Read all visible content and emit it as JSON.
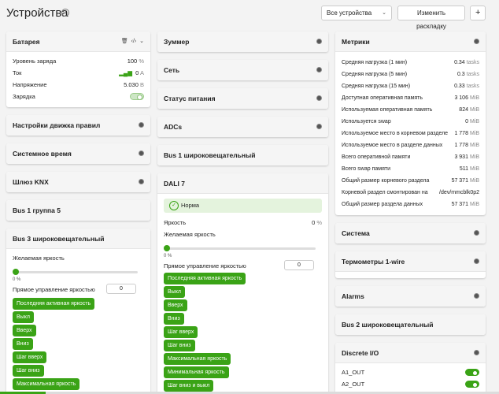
{
  "header": {
    "title": "Устройства",
    "devices_select": "Все устройства",
    "layout_button": "Изменить раскладку",
    "add_button": "+"
  },
  "battery": {
    "title": "Батарея",
    "rows": [
      {
        "label": "Уровень заряда",
        "value": "100",
        "unit": "%"
      },
      {
        "label": "Ток",
        "value": "0",
        "unit": "A"
      },
      {
        "label": "Напряжение",
        "value": "5.030",
        "unit": "В"
      },
      {
        "label": "Зарядка"
      }
    ]
  },
  "col1_cards": [
    "Настройки движка правил",
    "Системное время",
    "Шлюз KNX"
  ],
  "bus1g5": "Bus 1 группа 5",
  "bus3": {
    "title": "Bus 3 широковещательный",
    "desired_label": "Желаемая яркость",
    "desired_value": "0",
    "desired_unit": "%",
    "direct_label": "Прямое управление яркостью",
    "direct_value": "0",
    "buttons": [
      "Последняя активная яркость",
      "Выкл",
      "Вверх",
      "Вниз",
      "Шаг вверх",
      "Шаг вниз",
      "Максимальная яркость"
    ]
  },
  "col2_cards": [
    "Зуммер",
    "Сеть",
    "Статус питания",
    "ADCs"
  ],
  "bus1_broadcast": "Bus 1 широковещательный",
  "dali7": {
    "title": "DALI 7",
    "status": "Норма",
    "brightness_label": "Яркость",
    "brightness_value": "0",
    "brightness_unit": "%",
    "desired_label": "Желаемая яркость",
    "desired_value": "0",
    "desired_unit": "%",
    "direct_label": "Прямое управление яркостью",
    "direct_value": "0",
    "buttons": [
      "Последняя активная яркость",
      "Выкл",
      "Вверх",
      "Вниз",
      "Шаг вверх",
      "Шаг вниз",
      "Максимальная яркость",
      "Минимальная яркость",
      "Шаг вниз и выкл"
    ]
  },
  "metrics": {
    "title": "Метрики",
    "rows": [
      {
        "label": "Средняя нагрузка (1 мин)",
        "value": "0.34",
        "unit": "tasks"
      },
      {
        "label": "Средняя нагрузка (5 мин)",
        "value": "0.3",
        "unit": "tasks"
      },
      {
        "label": "Средняя нагрузка (15 мин)",
        "value": "0.33",
        "unit": "tasks"
      },
      {
        "label": "Доступная оперативная память",
        "value": "3 106",
        "unit": "MiB"
      },
      {
        "label": "Используемая оперативная память",
        "value": "824",
        "unit": "MiB"
      },
      {
        "label": "Используется swap",
        "value": "0",
        "unit": "MiB"
      },
      {
        "label": "Используемое место в корневом разделе",
        "value": "1 778",
        "unit": "MiB"
      },
      {
        "label": "Используемое место в разделе данных",
        "value": "1 778",
        "unit": "MiB"
      },
      {
        "label": "Всего оперативной памяти",
        "value": "3 931",
        "unit": "MiB"
      },
      {
        "label": "Всего swap памяти",
        "value": "511",
        "unit": "MiB"
      },
      {
        "label": "Общий размер корневого раздела",
        "value": "57 371",
        "unit": "MiB"
      },
      {
        "label": "Корневой раздел смонтирован на",
        "value": "/dev/mmcblk0p2",
        "unit": ""
      },
      {
        "label": "Общий размер раздела данных",
        "value": "57 371",
        "unit": "MiB"
      }
    ]
  },
  "system": "Система",
  "thermometers": "Термометры 1-wire",
  "alarms": "Alarms",
  "bus2": "Bus 2 широковещательный",
  "discrete": {
    "title": "Discrete I/O",
    "rows": [
      "A1_OUT",
      "A2_OUT"
    ]
  }
}
